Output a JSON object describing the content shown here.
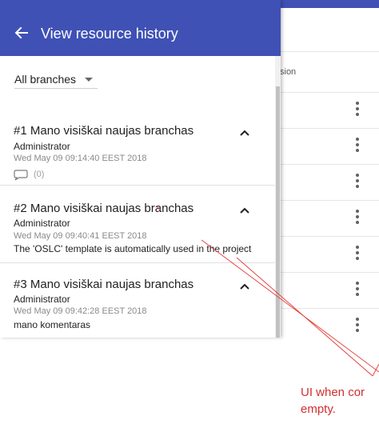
{
  "background_table": {
    "column_label": "sion",
    "row_count": 7
  },
  "panel": {
    "title": "View resource history",
    "back_icon": "arrow-left-icon",
    "branch_filter": "All branches"
  },
  "entries": [
    {
      "title": "#1 Mano visiškai naujas branchas",
      "author": "Administrator",
      "date": "Wed May 09 09:14:40 EEST 2018",
      "comment": "",
      "comment_count": "(0)"
    },
    {
      "title": "#2 Mano visiškai naujas branchas",
      "author": "Administrator",
      "date": "Wed May 09 09:40:41 EEST 2018",
      "comment": "The 'OSLC' template is automatically used in the project"
    },
    {
      "title": "#3 Mano visiškai naujas branchas",
      "author": "Administrator",
      "date": "Wed May 09 09:42:28 EEST 2018",
      "comment": "mano komentaras"
    }
  ],
  "annotation": {
    "line1": "UI when cor",
    "line2": "empty."
  },
  "colors": {
    "header": "#3f51b5",
    "annotation": "#d32f2f"
  }
}
